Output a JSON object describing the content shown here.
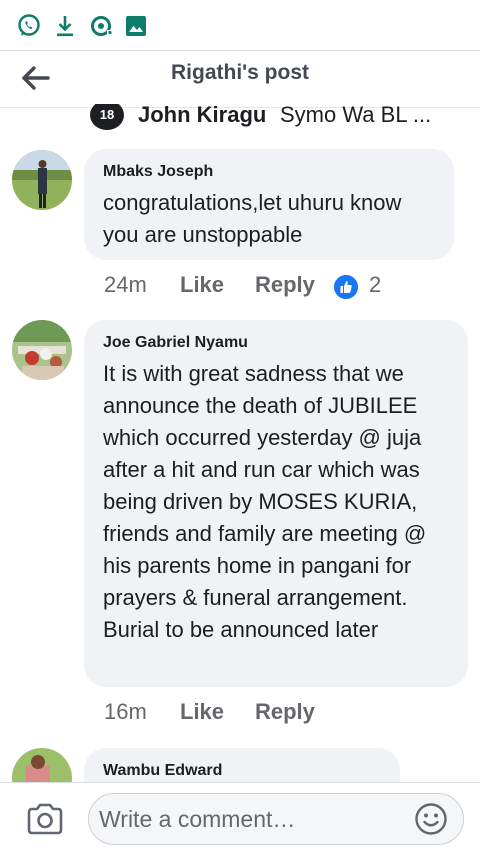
{
  "status_bar": {
    "icons": [
      "whatsapp-icon",
      "download-icon",
      "sync-icon",
      "image-icon"
    ]
  },
  "header": {
    "back_icon": "arrow-left-icon",
    "title": "Rigathi's post"
  },
  "partial_comment": {
    "badge": "18",
    "author": "John Kiragu",
    "text": "Symo Wa BL ..."
  },
  "comments": [
    {
      "author": "Mbaks Joseph",
      "text": "congratulations,let uhuru know you are unstoppable",
      "time": "24m",
      "like_label": "Like",
      "reply_label": "Reply",
      "reaction_icon": "like-reaction-icon",
      "reaction_count": "2"
    },
    {
      "author": "Joe Gabriel Nyamu",
      "text": "It is with great sadness that we announce the death of JUBILEE which occurred yesterday @ juja after a hit and run car which was being driven by MOSES KURIA, friends and family are meeting @ his parents home in pangani for prayers & funeral arrangement. Burial to be announced later",
      "time": "16m",
      "like_label": "Like",
      "reply_label": "Reply"
    },
    {
      "author": "Wambu Edward"
    }
  ],
  "composer": {
    "camera_icon": "camera-icon",
    "placeholder": "Write a comment…",
    "emoji_icon": "smiley-icon"
  },
  "colors": {
    "whatsapp": "#25d366",
    "icon_teal": "#0e7c6b",
    "bubble": "#f0f2f5",
    "secondary_text": "#65676b",
    "like_blue": "#1877f2"
  }
}
